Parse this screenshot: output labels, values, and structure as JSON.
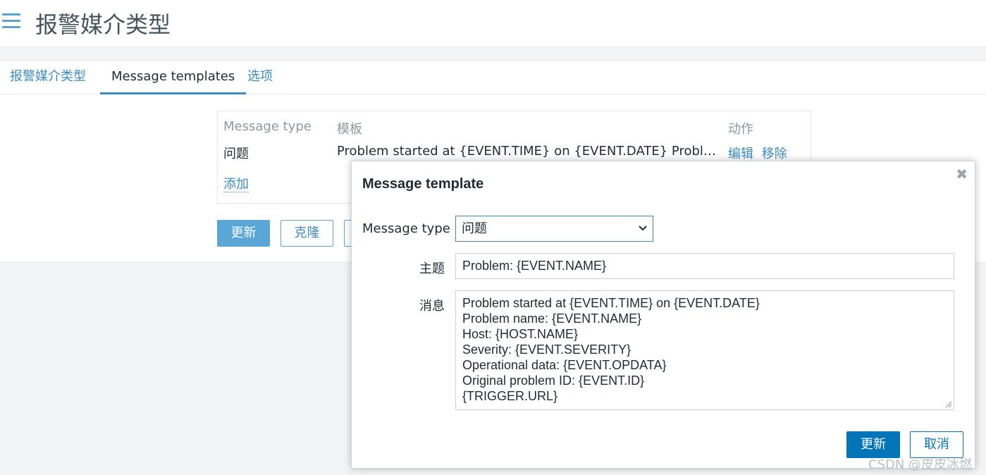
{
  "header": {
    "title": "报警媒介类型"
  },
  "tabs": [
    {
      "label": "报警媒介类型"
    },
    {
      "label": "Message templates"
    },
    {
      "label": "选项"
    }
  ],
  "table": {
    "headers": {
      "type": "Message type",
      "template": "模板",
      "actions": "动作"
    },
    "rows": [
      {
        "type": "问题",
        "template": "Problem started at {EVENT.TIME} on {EVENT.DATE} Problem name: {EVENT.NAME}",
        "edit": "编辑",
        "remove": "移除"
      }
    ],
    "add": "添加"
  },
  "form_buttons": {
    "update": "更新",
    "clone": "克隆"
  },
  "modal": {
    "title": "Message template",
    "message_type_label": "Message type",
    "message_type_value": "问题",
    "subject_label": "主题",
    "subject_value": "Problem: {EVENT.NAME}",
    "message_label": "消息",
    "message_lines": [
      "Problem started at {EVENT.TIME} on {EVENT.DATE}",
      "Problem name: {EVENT.NAME}",
      "Host: {HOST.NAME}",
      "Severity: {EVENT.SEVERITY}",
      "Operational data: {EVENT.OPDATA}",
      "Original problem ID: {EVENT.ID}",
      "{TRIGGER.URL}"
    ],
    "update": "更新",
    "cancel": "取消"
  },
  "watermark": "CSDN @皮皮冰燃",
  "colors": {
    "accent": "#3b8cc0",
    "primary_button": "#0275b8"
  }
}
